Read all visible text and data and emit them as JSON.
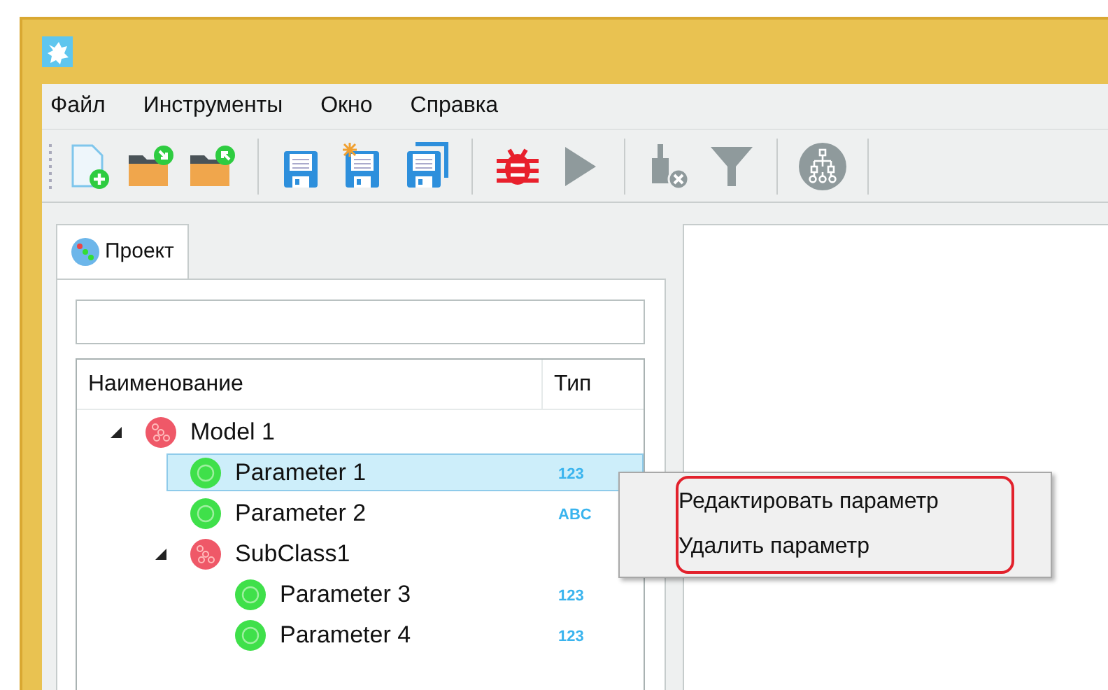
{
  "menu": [
    "Файл",
    "Инструменты",
    "Окно",
    "Справка"
  ],
  "toolbar": [
    {
      "kind": "new-file",
      "disabled": false
    },
    {
      "kind": "open-folder",
      "disabled": false
    },
    {
      "kind": "import-folder",
      "disabled": false
    },
    {
      "kind": "separator"
    },
    {
      "kind": "save",
      "disabled": false
    },
    {
      "kind": "save-new",
      "disabled": false
    },
    {
      "kind": "save-all",
      "disabled": false
    },
    {
      "kind": "separator"
    },
    {
      "kind": "bug",
      "disabled": false
    },
    {
      "kind": "play",
      "disabled": true
    },
    {
      "kind": "separator"
    },
    {
      "kind": "clear",
      "disabled": true
    },
    {
      "kind": "filter",
      "disabled": true
    },
    {
      "kind": "separator"
    },
    {
      "kind": "hierarchy",
      "disabled": true
    },
    {
      "kind": "separator"
    }
  ],
  "tabs": [
    {
      "label": "Проект",
      "selected": true
    }
  ],
  "tree": {
    "columns": [
      "Наименование",
      "Тип"
    ],
    "items": [
      {
        "name": "Model 1",
        "kind": "model",
        "expanded": true,
        "selected": false,
        "children": [
          {
            "name": "Parameter 1",
            "kind": "parameter",
            "type": "123",
            "selected": true
          },
          {
            "name": "Parameter 2",
            "kind": "parameter",
            "type": "ABC",
            "selected": false
          },
          {
            "name": "SubClass1",
            "kind": "model",
            "expanded": true,
            "selected": false,
            "children": [
              {
                "name": "Parameter 3",
                "kind": "parameter",
                "type": "123",
                "selected": false
              },
              {
                "name": "Parameter 4",
                "kind": "parameter",
                "type": "123",
                "selected": false
              }
            ]
          }
        ]
      }
    ]
  },
  "context_menu": {
    "items": [
      "Редактировать параметр",
      "Удалить параметр"
    ]
  }
}
